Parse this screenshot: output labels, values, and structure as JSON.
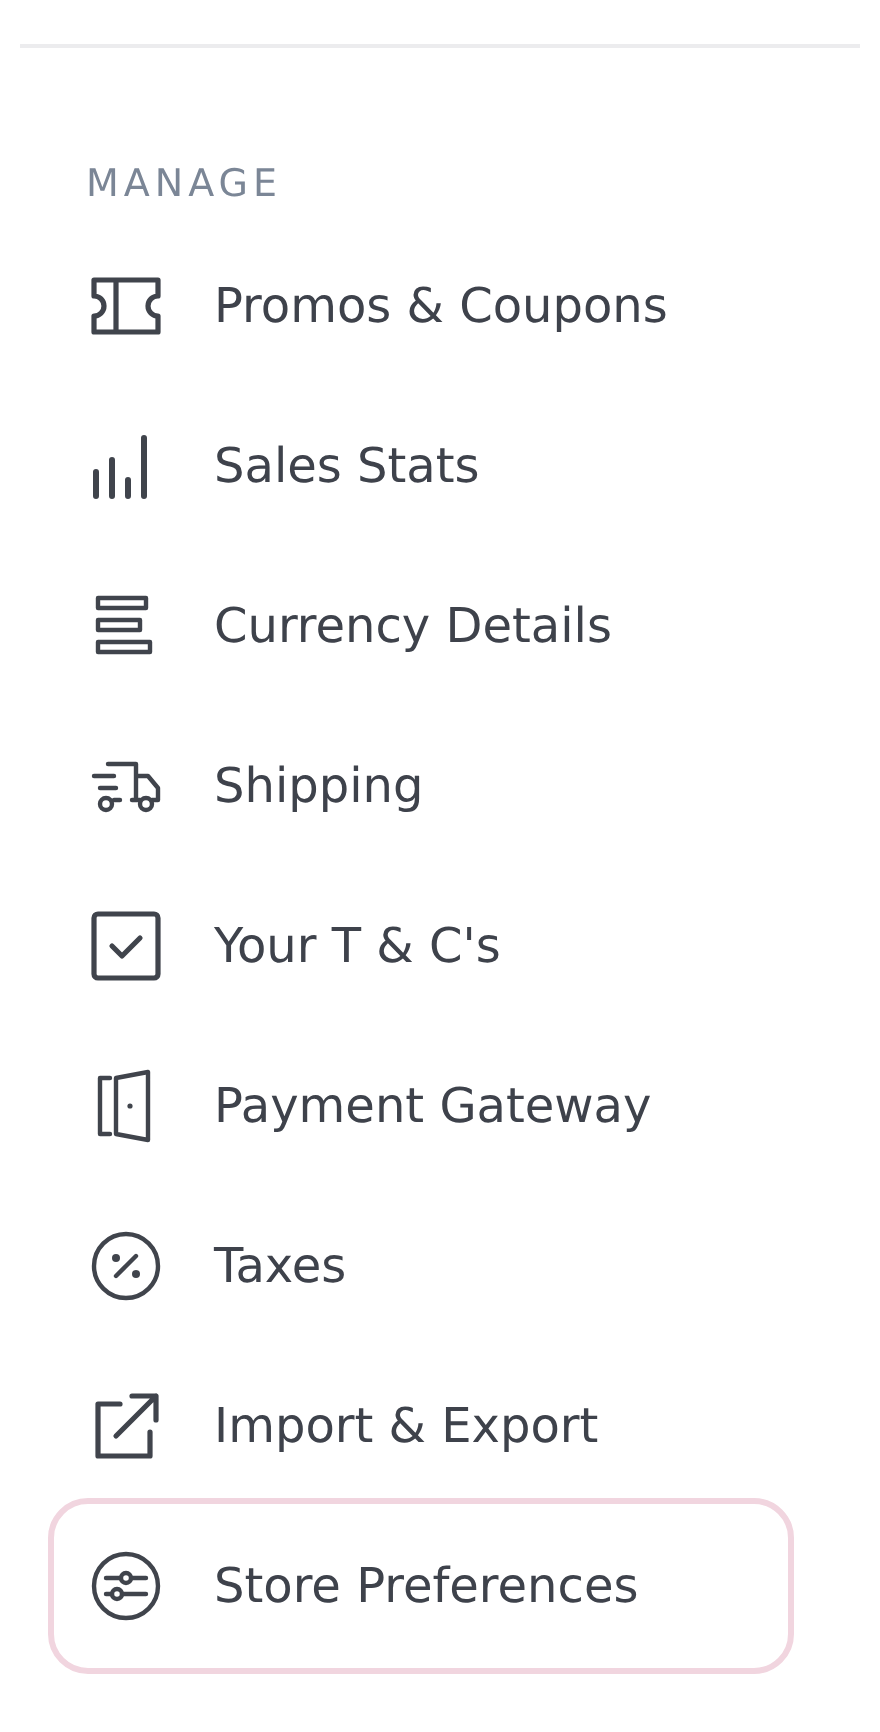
{
  "section_title": "MANAGE",
  "items": [
    {
      "label": "Promos & Coupons",
      "selected": false
    },
    {
      "label": "Sales Stats",
      "selected": false
    },
    {
      "label": "Currency Details",
      "selected": false
    },
    {
      "label": "Shipping",
      "selected": false
    },
    {
      "label": "Your T & C's",
      "selected": false
    },
    {
      "label": "Payment Gateway",
      "selected": false
    },
    {
      "label": "Taxes",
      "selected": false
    },
    {
      "label": "Import & Export",
      "selected": false
    },
    {
      "label": "Store Preferences",
      "selected": true
    }
  ]
}
